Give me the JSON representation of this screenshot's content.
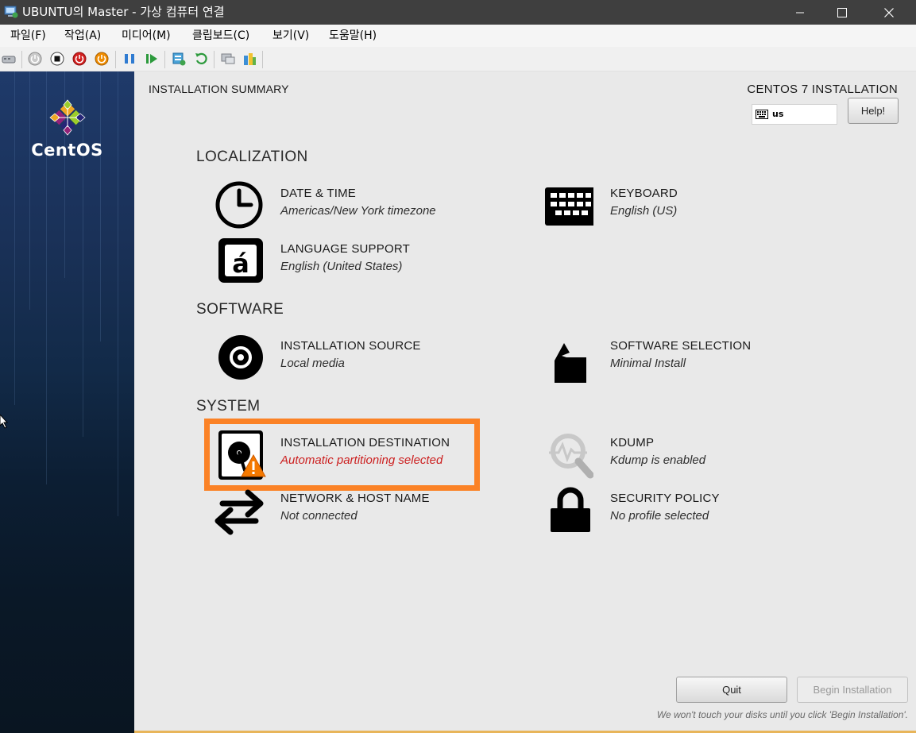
{
  "window": {
    "title": "UBUNTU의 Master - 가상 컴퓨터 연결"
  },
  "menu": [
    "파일(F)",
    "작업(A)",
    "미디어(M)",
    "클립보드(C)",
    "보기(V)",
    "도움말(H)"
  ],
  "toolbar_icons": [
    "ctrl-alt-del-icon",
    "start-icon",
    "turn-off-icon",
    "shutdown-icon",
    "save-icon",
    "pause-icon",
    "reset-icon",
    "checkpoint-icon",
    "revert-icon",
    "enhanced-session-icon",
    "share-icon"
  ],
  "installer": {
    "brand": "CentOS",
    "summary_title": "INSTALLATION SUMMARY",
    "product_title": "CENTOS 7 INSTALLATION",
    "keyboard_layout": "us",
    "help_label": "Help!",
    "sections": {
      "localization": "LOCALIZATION",
      "software": "SOFTWARE",
      "system": "SYSTEM"
    },
    "spokes": {
      "date_time": {
        "name": "DATE & TIME",
        "status": "Americas/New York timezone"
      },
      "keyboard": {
        "name": "KEYBOARD",
        "status": "English (US)"
      },
      "language": {
        "name": "LANGUAGE SUPPORT",
        "status": "English (United States)"
      },
      "source": {
        "name": "INSTALLATION SOURCE",
        "status": "Local media"
      },
      "software_selection": {
        "name": "SOFTWARE SELECTION",
        "status": "Minimal Install"
      },
      "destination": {
        "name": "INSTALLATION DESTINATION",
        "status": "Automatic partitioning selected"
      },
      "kdump": {
        "name": "KDUMP",
        "status": "Kdump is enabled"
      },
      "network": {
        "name": "NETWORK & HOST NAME",
        "status": "Not connected"
      },
      "security": {
        "name": "SECURITY POLICY",
        "status": "No profile selected"
      }
    },
    "quit_label": "Quit",
    "begin_label": "Begin Installation",
    "footnote": "We won't touch your disks until you click 'Begin Installation'."
  },
  "colors": {
    "highlight": "#fb8226",
    "warning_text": "#cc1f1f",
    "warning_badge": "#f57900"
  }
}
